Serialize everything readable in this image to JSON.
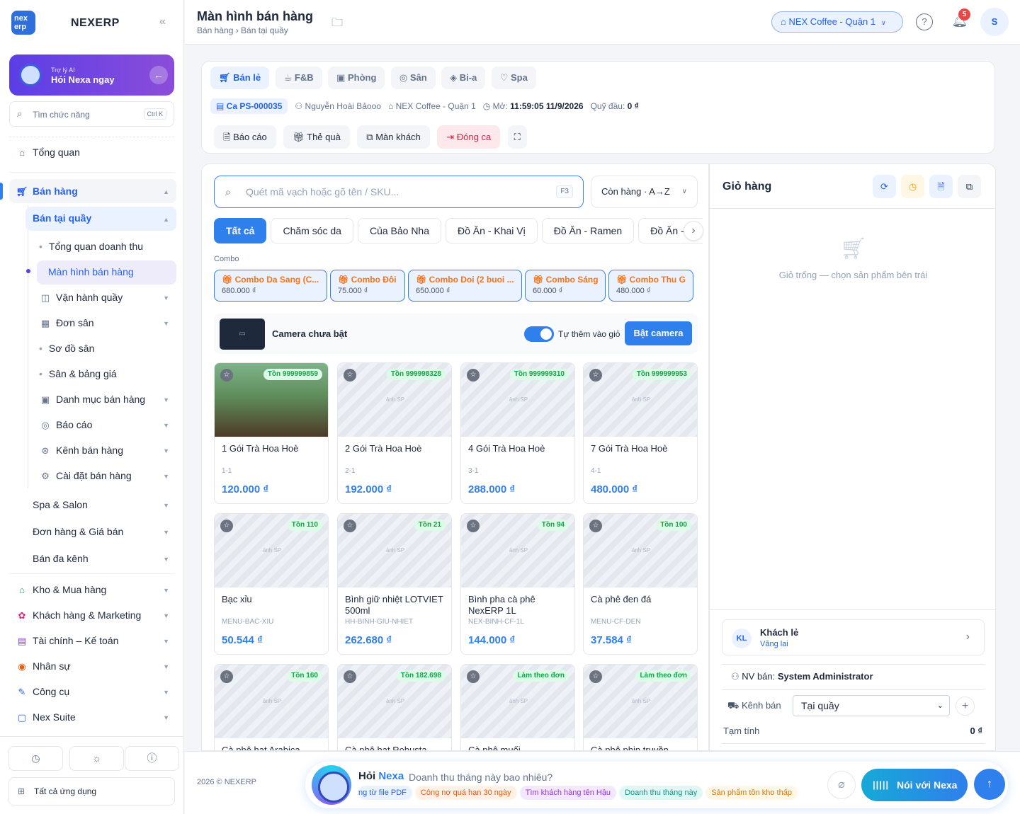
{
  "sidebar": {
    "logo": "nex erp",
    "brand": "NEXERP",
    "ai_small": "Trợ lý AI",
    "ai_big": "Hỏi Nexa ngay",
    "search_placeholder": "Tìm chức năng",
    "search_shortcut": "Ctrl K",
    "nav": {
      "overview": "Tổng quan",
      "sales": "Bán hàng",
      "pos": "Bán tại quầy",
      "revenue": "Tổng quan doanh thu",
      "sales_screen": "Màn hình bán hàng",
      "counter_ops": "Vận hành quầy",
      "court_orders": "Đơn sân",
      "court_map": "Sơ đồ sân",
      "court_prices": "Sân & bảng giá",
      "catalog": "Danh mục bán hàng",
      "reports": "Báo cáo",
      "channels": "Kênh bán hàng",
      "settings": "Cài đặt bán hàng",
      "spa": "Spa & Salon",
      "orders": "Đơn hàng & Giá bán",
      "omni": "Bán đa kênh",
      "inventory": "Kho & Mua hàng",
      "crm": "Khách hàng & Marketing",
      "finance": "Tài chính – Kế toán",
      "hr": "Nhân sự",
      "tools": "Công cụ",
      "suite": "Nex Suite"
    },
    "all_apps": "Tất cả ứng dụng"
  },
  "header": {
    "title": "Màn hình bán hàng",
    "breadcrumb": "Bán hàng › Bán tại quầy",
    "branch": "NEX Coffee - Quận 1",
    "notifications": "5",
    "avatar": "S"
  },
  "toolbar": {
    "modes": [
      "Bán lẻ",
      "F&B",
      "Phòng",
      "Sân",
      "Bi-a",
      "Spa"
    ],
    "shift_id": "Ca PS-000035",
    "cashier": "Nguyễn Hoài Bảooo",
    "store": "NEX Coffee - Quận 1",
    "opened_label": "Mở:",
    "opened_at": "11:59:05 11/9/2026",
    "opening_cash_label": "Quỹ đầu:",
    "opening_cash": "0 ₫",
    "actions": [
      "Báo cáo",
      "Thẻ quà",
      "Màn khách",
      "Đóng ca"
    ]
  },
  "products": {
    "search_placeholder": "Quét mã vạch hoặc gõ tên / SKU...",
    "search_shortcut": "F3",
    "sort": "Còn hàng · A→Z",
    "categories": [
      "Tất cả",
      "Chăm sóc da",
      "Của Bảo Nha",
      "Đồ Ăn - Khai Vị",
      "Đồ Ăn - Ramen",
      "Đồ Ăn - Chính"
    ],
    "combo_label": "Combo",
    "combos": [
      {
        "name": "Combo Da Sang (C...",
        "price": "680.000 ₫"
      },
      {
        "name": "Combo Đôi",
        "price": "75.000 ₫"
      },
      {
        "name": "Combo Doi (2 buoi ...",
        "price": "650.000 ₫"
      },
      {
        "name": "Combo Sáng",
        "price": "60.000 ₫"
      },
      {
        "name": "Combo Thu Giãn",
        "price": "480.000 ₫"
      }
    ],
    "camera_text": "Camera chưa bật",
    "auto_add": "Tự thêm vào giỏ",
    "camera_button": "Bật camera",
    "image_placeholder": "ảnh SP",
    "items": [
      {
        "name": "1 Gói Trà Hoa Hoè",
        "sku": "1-1",
        "price": "120.000 ₫",
        "stock": "Tồn 999999859"
      },
      {
        "name": "2 Gói Trà Hoa Hoè",
        "sku": "2-1",
        "price": "192.000 ₫",
        "stock": "Tồn 999998328"
      },
      {
        "name": "4 Gói Trà Hoa Hoè",
        "sku": "3-1",
        "price": "288.000 ₫",
        "stock": "Tồn 999999310"
      },
      {
        "name": "7 Gói Trà Hoa Hoè",
        "sku": "4-1",
        "price": "480.000 ₫",
        "stock": "Tồn 999999953"
      },
      {
        "name": "Bạc xỉu",
        "sku": "MENU-BAC-XIU",
        "price": "50.544 ₫",
        "stock": "Tồn 110"
      },
      {
        "name": "Bình giữ nhiệt LOTVIET 500ml",
        "sku": "HH-BINH-GIU-NHIET",
        "price": "262.680 ₫",
        "stock": "Tồn 21"
      },
      {
        "name": "Bình pha cà phê NexERP 1L",
        "sku": "NEX-BINH-CF-1L",
        "price": "144.000 ₫",
        "stock": "Tồn 94"
      },
      {
        "name": "Cà phê đen đá",
        "sku": "MENU-CF-DEN",
        "price": "37.584 ₫",
        "stock": "Tồn 100"
      },
      {
        "name": "Cà phê hạt Arabica",
        "sku": "",
        "price": "",
        "stock": "Tồn 160"
      },
      {
        "name": "Cà phê hạt Robusta",
        "sku": "",
        "price": "",
        "stock": "Tồn 182.698"
      },
      {
        "name": "Cà phê muối",
        "sku": "",
        "price": "",
        "stock": "Làm theo đơn"
      },
      {
        "name": "Cà phê phin truyền",
        "sku": "",
        "price": "",
        "stock": "Làm theo đơn"
      }
    ]
  },
  "cart": {
    "title": "Giỏ hàng",
    "empty": "Giỏ trống — chọn sản phẩm bên trái",
    "customer_initials": "KL",
    "customer_name": "Khách lẻ",
    "customer_status": "Vãng lai",
    "seller_label": "NV bán:",
    "seller": "System Administrator",
    "channel_label": "Kênh bán",
    "channel": "Tại quầy",
    "subtotal_label": "Tạm tính",
    "subtotal": "0 ₫"
  },
  "footer": {
    "copyright": "2026 © NEXERP",
    "ask": "Hỏi",
    "nexa": "Nexa",
    "question": "Doanh thu tháng này bao nhiêu?",
    "chips": [
      "ng từ file PDF",
      "Công nợ quá hạn 30 ngày",
      "Tìm khách hàng tên Hậu",
      "Doanh thu tháng này",
      "Sản phẩm tồn kho thấp"
    ],
    "talk": "Nói với Nexa"
  },
  "colors": {
    "primary": "#2f80ed",
    "danger": "#e11d48",
    "stock_green": "#16a34a",
    "ai_purple": "#5b3ee6"
  }
}
